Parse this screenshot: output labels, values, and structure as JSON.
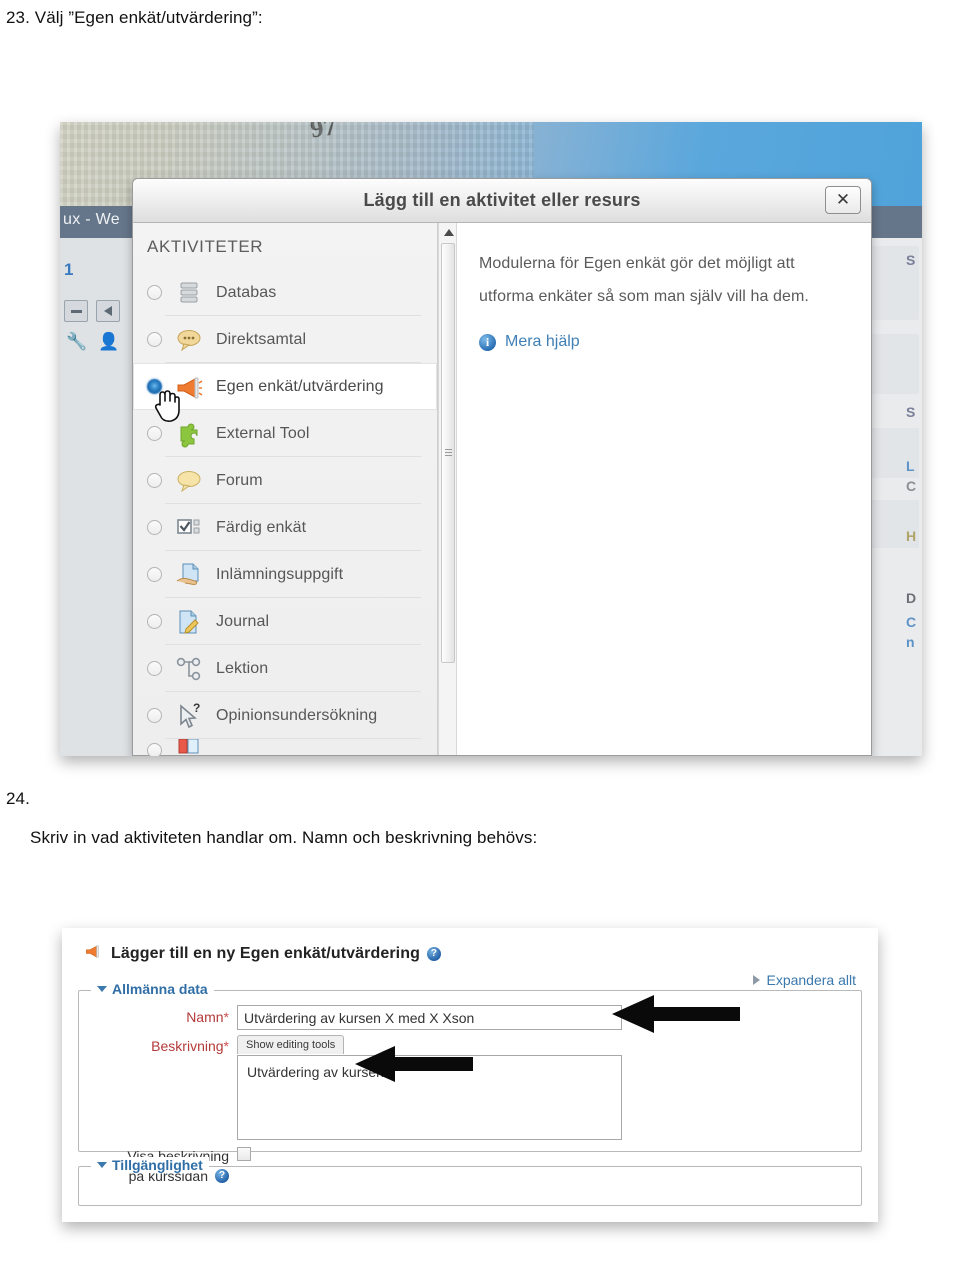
{
  "document": {
    "step23_number": "23.",
    "step23_text": "Välj ”Egen enkät/utvärdering”:",
    "step24_number": "24.",
    "step24_text": "Skriv in vad aktiviteten handlar om. Namn och beskrivning behövs:"
  },
  "screenshot1": {
    "background": {
      "site_title_fragment": "ux - We",
      "left_number": "1",
      "wrench_icon": "wrench-icon",
      "adduser_icon": "add-user-icon",
      "right_fragments": [
        "S",
        "S",
        "L",
        "C",
        "H",
        "D",
        "C",
        "n"
      ]
    },
    "dialog": {
      "title": "Lägg till en aktivitet eller resurs",
      "close_label": "✕",
      "section_title": "AKTIVITETER",
      "activities": [
        {
          "label": "Databas",
          "icon": "database-icon",
          "selected": false
        },
        {
          "label": "Direktsamtal",
          "icon": "chat-bubble-icon",
          "selected": false
        },
        {
          "label": "Egen enkät/utvärdering",
          "icon": "megaphone-icon",
          "selected": true
        },
        {
          "label": "External Tool",
          "icon": "puzzle-piece-icon",
          "selected": false
        },
        {
          "label": "Forum",
          "icon": "speech-bubble-icon",
          "selected": false
        },
        {
          "label": "Färdig enkät",
          "icon": "checklist-icon",
          "selected": false
        },
        {
          "label": "Inlämningsuppgift",
          "icon": "hand-paper-icon",
          "selected": false
        },
        {
          "label": "Journal",
          "icon": "pencil-page-icon",
          "selected": false
        },
        {
          "label": "Lektion",
          "icon": "flowchart-icon",
          "selected": false
        },
        {
          "label": "Opinionsundersökning",
          "icon": "cursor-question-icon",
          "selected": false
        }
      ],
      "description": "Modulerna för Egen enkät gör det möjligt att utforma enkäter så som man själv vill ha dem.",
      "more_help_label": "Mera hjälp",
      "more_help_icon": "info-icon",
      "scrollbar": "vertical-scrollbar",
      "cursor": "hand-pointer-cursor",
      "accent_color": "#2a7fc4"
    }
  },
  "screenshot2": {
    "heading": "Lägger till en ny Egen enkät/utvärdering",
    "heading_icon": "megaphone-icon",
    "heading_help_icon": "help-icon",
    "expand_all_label": "Expandera allt",
    "general_section_legend": "Allmänna data",
    "name_label": "Namn",
    "name_required_mark": "*",
    "name_value": "Utvärdering av kursen X med X Xson",
    "description_label": "Beskrivning",
    "description_required_mark": "*",
    "editor_tab_label": "Show editing tools",
    "description_value": "Utvärdering av kursen",
    "show_description_label_line1": "Visa beskrivning",
    "show_description_label_line2": "på kurssidan",
    "show_description_checked": false,
    "show_description_help_icon": "help-icon",
    "availability_section_legend": "Tillgänglighet",
    "annotation_arrows": [
      "arrow-pointing-to-name-field",
      "arrow-pointing-to-description-field"
    ],
    "link_color": "#3a78ad",
    "required_color": "#b33a3a"
  }
}
